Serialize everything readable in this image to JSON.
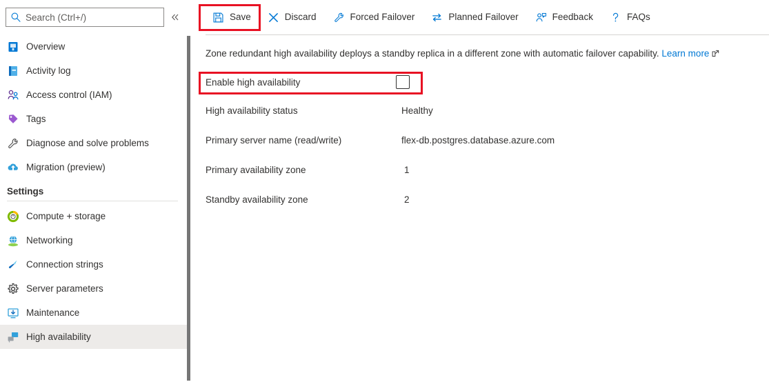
{
  "search": {
    "placeholder": "Search (Ctrl+/)",
    "value": "",
    "icon": "search-icon"
  },
  "collapse": {
    "label": "«",
    "icon": "chevron-double-left-icon"
  },
  "sidebar": {
    "items": [
      {
        "label": "Overview",
        "icon": "overview-icon",
        "selected": false
      },
      {
        "label": "Activity log",
        "icon": "activity-log-icon",
        "selected": false
      },
      {
        "label": "Access control (IAM)",
        "icon": "access-control-icon",
        "selected": false
      },
      {
        "label": "Tags",
        "icon": "tags-icon",
        "selected": false
      },
      {
        "label": "Diagnose and solve problems",
        "icon": "wrench-icon",
        "selected": false
      },
      {
        "label": "Migration (preview)",
        "icon": "migration-icon",
        "selected": false
      }
    ],
    "section_title": "Settings",
    "settings_items": [
      {
        "label": "Compute + storage",
        "icon": "compute-storage-icon",
        "selected": false
      },
      {
        "label": "Networking",
        "icon": "networking-icon",
        "selected": false
      },
      {
        "label": "Connection strings",
        "icon": "connection-strings-icon",
        "selected": false
      },
      {
        "label": "Server parameters",
        "icon": "gear-icon",
        "selected": false
      },
      {
        "label": "Maintenance",
        "icon": "maintenance-icon",
        "selected": false
      },
      {
        "label": "High availability",
        "icon": "high-availability-icon",
        "selected": true
      }
    ]
  },
  "toolbar": {
    "save_label": "Save",
    "discard_label": "Discard",
    "forced_failover_label": "Forced Failover",
    "planned_failover_label": "Planned Failover",
    "feedback_label": "Feedback",
    "faqs_label": "FAQs"
  },
  "main": {
    "intro_text": "Zone redundant high availability deploys a standby replica in a different zone with automatic failover capability.",
    "learn_more_label": "Learn more",
    "enable_label": "Enable high availability",
    "enable_checked": false,
    "fields": [
      {
        "label": "High availability status",
        "value": "Healthy"
      },
      {
        "label": "Primary server name (read/write)",
        "value": "flex-db.postgres.database.azure.com"
      },
      {
        "label": "Primary availability zone",
        "value": "1"
      },
      {
        "label": "Standby availability zone",
        "value": "2"
      }
    ]
  },
  "colors": {
    "accent": "#0078d4",
    "highlight": "#e81123",
    "selected_bg": "#edebe9",
    "text": "#323130"
  }
}
